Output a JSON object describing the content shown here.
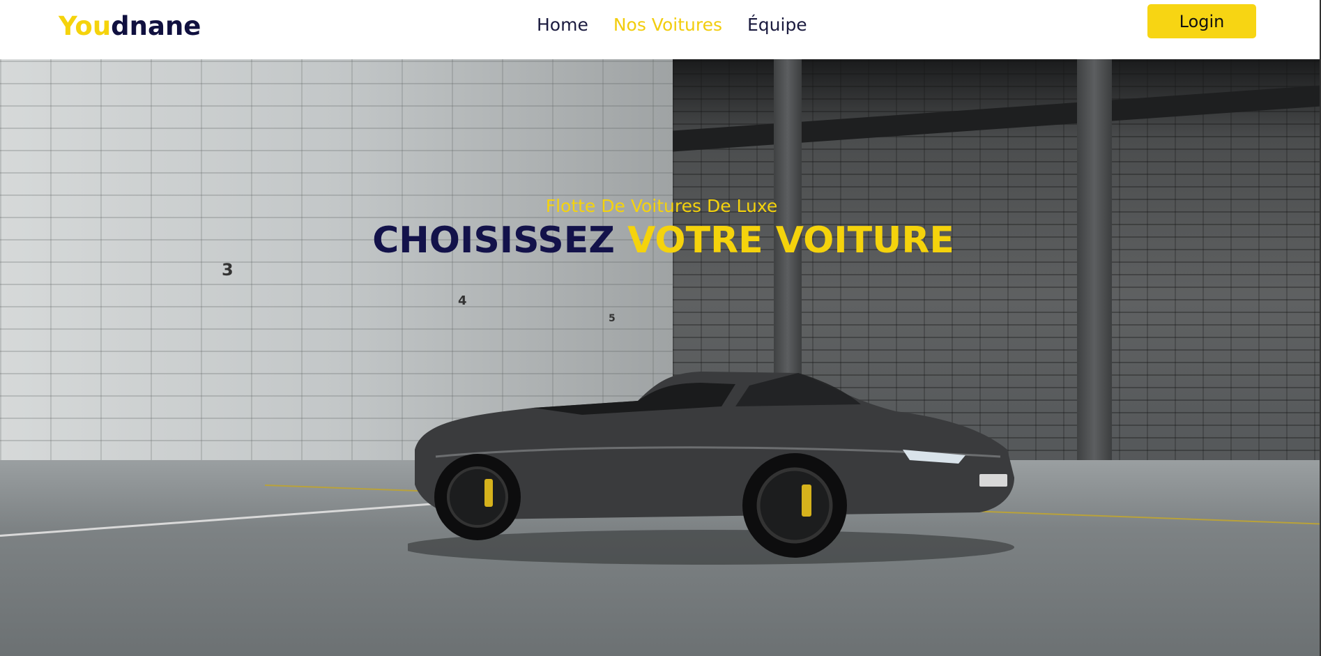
{
  "brand": {
    "part1": "You",
    "part2": "dnane"
  },
  "nav": {
    "home": "Home",
    "cars": "Nos Voitures",
    "team": "Équipe"
  },
  "login_label": "Login",
  "hero": {
    "tagline": "Flotte De Voitures De Luxe",
    "headline_dark": "CHOISISSEZ",
    "headline_yellow": "VOTRE VOITURE",
    "wall_numbers": [
      "3",
      "4",
      "5"
    ]
  },
  "colors": {
    "accent": "#f5d30c",
    "dark": "#13124a"
  }
}
